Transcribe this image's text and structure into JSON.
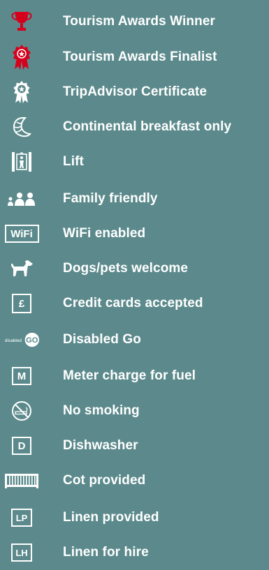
{
  "amenities": {
    "items": [
      {
        "label": "Tourism Awards Winner",
        "icon": "trophy-icon",
        "color": "#d6001c"
      },
      {
        "label": "Tourism Awards Finalist",
        "icon": "rosette-icon",
        "color": "#d6001c"
      },
      {
        "label": "TripAdvisor Certificate",
        "icon": "rosette-outline-icon"
      },
      {
        "label": "Continental breakfast only",
        "icon": "croissant-icon"
      },
      {
        "label": "Lift",
        "icon": "lift-icon"
      },
      {
        "label": "Family friendly",
        "icon": "family-icon"
      },
      {
        "label": "WiFi enabled",
        "icon": "wifi-icon",
        "badge": "WiFi"
      },
      {
        "label": "Dogs/pets welcome",
        "icon": "dog-icon"
      },
      {
        "label": "Credit cards accepted",
        "icon": "credit-card-icon",
        "badge": "£"
      },
      {
        "label": "Disabled Go",
        "icon": "disabled-go-icon",
        "badge": "GO"
      },
      {
        "label": "Meter charge for fuel",
        "icon": "meter-icon",
        "badge": "M"
      },
      {
        "label": "No smoking",
        "icon": "no-smoking-icon"
      },
      {
        "label": "Dishwasher",
        "icon": "dishwasher-icon",
        "badge": "D"
      },
      {
        "label": "Cot provided",
        "icon": "cot-icon"
      },
      {
        "label": "Linen provided",
        "icon": "linen-provided-icon",
        "badge": "LP"
      },
      {
        "label": "Linen for hire",
        "icon": "linen-hire-icon",
        "badge": "LH"
      }
    ]
  }
}
